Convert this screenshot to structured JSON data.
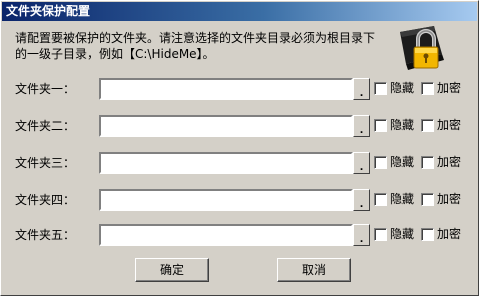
{
  "window": {
    "title": "文件夹保护配置"
  },
  "description": "请配置要被保护的文件夹。请注意选择的文件夹目录必须为根目录下的一级子目录，例如【C:\\HideMe】。",
  "icons": {
    "header": "padlock-icon"
  },
  "folders": [
    {
      "label": "文件夹一：",
      "value": "",
      "browse_label": ".",
      "hide_label": "隐藏",
      "hide_checked": false,
      "encrypt_label": "加密",
      "encrypt_checked": false
    },
    {
      "label": "文件夹二：",
      "value": "",
      "browse_label": ".",
      "hide_label": "隐藏",
      "hide_checked": false,
      "encrypt_label": "加密",
      "encrypt_checked": false
    },
    {
      "label": "文件夹三：",
      "value": "",
      "browse_label": ".",
      "hide_label": "隐藏",
      "hide_checked": false,
      "encrypt_label": "加密",
      "encrypt_checked": false
    },
    {
      "label": "文件夹四：",
      "value": "",
      "browse_label": ".",
      "hide_label": "隐藏",
      "hide_checked": false,
      "encrypt_label": "加密",
      "encrypt_checked": false
    },
    {
      "label": "文件夹五：",
      "value": "",
      "browse_label": ".",
      "hide_label": "隐藏",
      "hide_checked": false,
      "encrypt_label": "加密",
      "encrypt_checked": false
    }
  ],
  "buttons": {
    "ok_label": "确定",
    "cancel_label": "取消"
  },
  "colors": {
    "titlebar_start": "#0a246a",
    "titlebar_end": "#a6caf0",
    "dialog_bg": "#d4d0c8",
    "lock_gold": "#f2b600"
  }
}
